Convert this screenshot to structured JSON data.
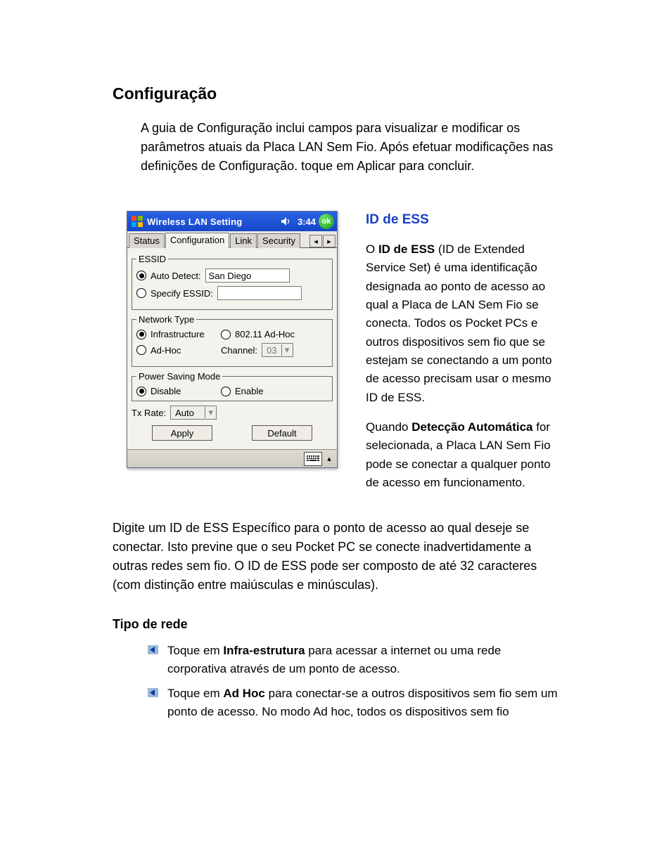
{
  "heading": "Configuração",
  "intro": "A guia de Configuração inclui campos para visualizar e modificar os parâmetros atuais da Placa LAN Sem Fio. Após efetuar modificações nas definições de Configuração. toque em Aplicar para concluir.",
  "aside": {
    "heading": "ID de ESS",
    "p1_pre": "O ",
    "p1_bold": "ID de ESS",
    "p1_post": " (ID de Extended Service Set) é uma identificação designada ao ponto de acesso ao qual a Placa de LAN Sem Fio se conecta. Todos os Pocket PCs e outros dispositivos sem fio que se estejam se conectando a um ponto de acesso precisam usar o mesmo ID de ESS.",
    "p2_pre": "Quando ",
    "p2_bold": "Detecção Automática",
    "p2_post": " for selecionada, a Placa LAN Sem Fio pode se conectar a qualquer ponto de acesso em funcionamento."
  },
  "after_figure": "Digite um ID de ESS Específico para o ponto de acesso ao qual deseje se conectar.  Isto previne que o seu Pocket PC se conecte inadvertidamente a outras redes sem fio.  O ID de ESS pode ser composto de até 32 caracteres (com distinção entre maiúsculas e minúsculas).",
  "section2": {
    "heading": "Tipo de rede",
    "item1_pre": "Toque em ",
    "item1_bold": "Infra-estrutura",
    "item1_post": " para acessar a internet ou uma rede corporativa através de um ponto de acesso.",
    "item2_pre": "Toque em ",
    "item2_bold": "Ad Hoc",
    "item2_post": " para conectar-se a outros dispositivos sem fio sem um ponto de acesso. No modo Ad hoc, todos os dispositivos sem fio"
  },
  "device": {
    "title": "Wireless LAN Setting",
    "clock": "3:44",
    "ok": "ok",
    "tabs": {
      "status": "Status",
      "configuration": "Configuration",
      "link": "Link",
      "security": "Security"
    },
    "essid": {
      "legend": "ESSID",
      "auto_detect": "Auto Detect:",
      "auto_value": "San Diego",
      "specify": "Specify ESSID:"
    },
    "nettype": {
      "legend": "Network Type",
      "infrastructure": "Infrastructure",
      "wifi_adhoc": "802.11 Ad-Hoc",
      "adhoc": "Ad-Hoc",
      "channel_label": "Channel:",
      "channel_value": "03"
    },
    "psm": {
      "legend": "Power Saving Mode",
      "disable": "Disable",
      "enable": "Enable"
    },
    "txrate_label": "Tx Rate:",
    "txrate_value": "Auto",
    "apply": "Apply",
    "default": "Default"
  }
}
